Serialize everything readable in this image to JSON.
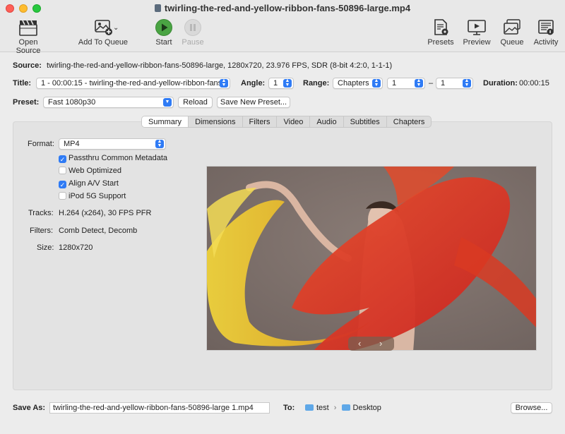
{
  "window": {
    "title": "twirling-the-red-and-yellow-ribbon-fans-50896-large.mp4"
  },
  "toolbar": {
    "open_source": "Open Source",
    "add_to_queue": "Add To Queue",
    "start": "Start",
    "pause": "Pause",
    "presets": "Presets",
    "preview": "Preview",
    "queue": "Queue",
    "activity": "Activity"
  },
  "source": {
    "label": "Source:",
    "value": "twirling-the-red-and-yellow-ribbon-fans-50896-large, 1280x720, 23.976 FPS, SDR (8-bit 4:2:0, 1-1-1)"
  },
  "title_row": {
    "label": "Title:",
    "title_value": "1 - 00:00:15 - twirling-the-red-and-yellow-ribbon-fans",
    "angle_label": "Angle:",
    "angle_value": "1",
    "range_label": "Range:",
    "range_value": "Chapters",
    "range_start": "1",
    "range_dash": "–",
    "range_end": "1",
    "duration_label": "Duration:",
    "duration_value": "00:00:15"
  },
  "preset_row": {
    "label": "Preset:",
    "value": "Fast 1080p30",
    "reload": "Reload",
    "save_new": "Save New Preset..."
  },
  "tabs": [
    "Summary",
    "Dimensions",
    "Filters",
    "Video",
    "Audio",
    "Subtitles",
    "Chapters"
  ],
  "summary": {
    "format_label": "Format:",
    "format_value": "MP4",
    "checkboxes": [
      {
        "label": "Passthru Common Metadata",
        "checked": true
      },
      {
        "label": "Web Optimized",
        "checked": false
      },
      {
        "label": "Align A/V Start",
        "checked": true
      },
      {
        "label": "iPod 5G Support",
        "checked": false
      }
    ],
    "tracks_label": "Tracks:",
    "tracks_value": "H.264 (x264), 30 FPS PFR",
    "filters_label": "Filters:",
    "filters_value": "Comb Detect, Decomb",
    "size_label": "Size:",
    "size_value": "1280x720"
  },
  "preview_nav": {
    "prev": "‹",
    "next": "›"
  },
  "save": {
    "label": "Save As:",
    "filename": "twirling-the-red-and-yellow-ribbon-fans-50896-large 1.mp4",
    "to_label": "To:",
    "path_1": "test",
    "path_sep": "›",
    "path_2": "Desktop",
    "browse": "Browse..."
  },
  "colors": {
    "accent": "#2f7bf5",
    "start_green": "#3f9a3a"
  }
}
